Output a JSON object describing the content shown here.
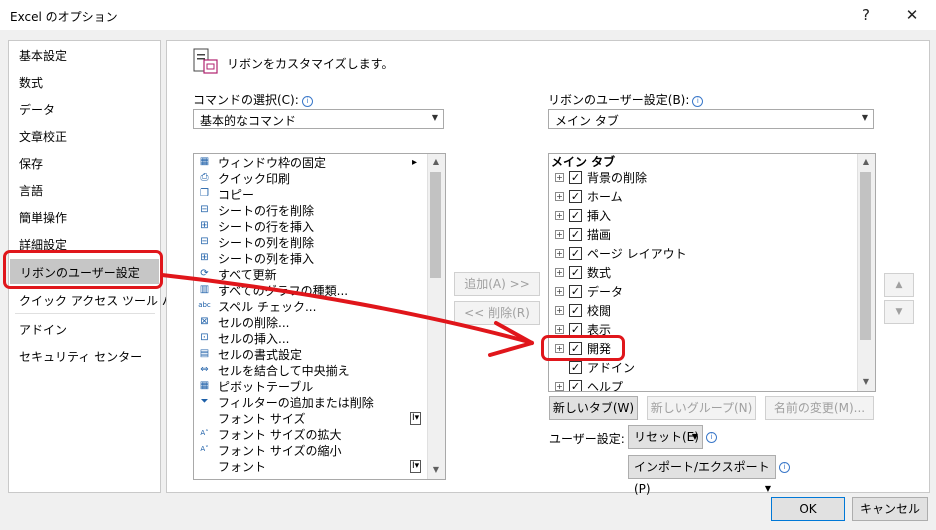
{
  "window": {
    "title": "Excel のオプション",
    "help": "?",
    "close": "✕"
  },
  "nav": {
    "items": [
      {
        "label": "基本設定"
      },
      {
        "label": "数式"
      },
      {
        "label": "データ"
      },
      {
        "label": "文章校正"
      },
      {
        "label": "保存"
      },
      {
        "label": "言語"
      },
      {
        "label": "簡単操作"
      },
      {
        "label": "詳細設定"
      },
      {
        "label": "リボンのユーザー設定"
      },
      {
        "label": "クイック アクセス ツール バー"
      },
      {
        "label": "アドイン"
      },
      {
        "label": "セキュリティ センター"
      }
    ]
  },
  "main": {
    "heading": "リボンをカスタマイズします。",
    "commands_label": "コマンドの選択(C):",
    "commands_value": "基本的なコマンド",
    "ribbon_label": "リボンのユーザー設定(B):",
    "ribbon_value": "メイン タブ",
    "commands": [
      {
        "label": "ウィンドウ枠の固定",
        "icon": "▦",
        "arrow": "▸"
      },
      {
        "label": "クイック印刷",
        "icon": "⎙"
      },
      {
        "label": "コピー",
        "icon": "❐"
      },
      {
        "label": "シートの行を削除",
        "icon": "⊟"
      },
      {
        "label": "シートの行を挿入",
        "icon": "⊞"
      },
      {
        "label": "シートの列を削除",
        "icon": "⊟"
      },
      {
        "label": "シートの列を挿入",
        "icon": "⊞"
      },
      {
        "label": "すべて更新",
        "icon": "⟳"
      },
      {
        "label": "すべてのグラフの種類...",
        "icon": "▥"
      },
      {
        "label": "スペル チェック...",
        "icon": "abc"
      },
      {
        "label": "セルの削除...",
        "icon": "⊠"
      },
      {
        "label": "セルの挿入...",
        "icon": "⊡"
      },
      {
        "label": "セルの書式設定",
        "icon": "▤"
      },
      {
        "label": "セルを結合して中央揃え",
        "icon": "⇔"
      },
      {
        "label": "ピボットテーブル",
        "icon": "▦"
      },
      {
        "label": "フィルターの追加または削除",
        "icon": "⏷"
      },
      {
        "label": "フォント サイズ",
        "icon": "",
        "right": "I▾"
      },
      {
        "label": "フォント サイズの拡大",
        "icon": "A˄"
      },
      {
        "label": "フォント サイズの縮小",
        "icon": "A˅"
      },
      {
        "label": "フォント",
        "icon": "",
        "right": "I▾"
      }
    ],
    "add_button": "追加(A) >>",
    "remove_button": "<< 削除(R)",
    "tabs_header": "メイン タブ",
    "tabs": [
      {
        "label": "背景の削除",
        "expand": "⊞",
        "checked": "✓"
      },
      {
        "label": "ホーム",
        "expand": "⊞",
        "checked": "✓"
      },
      {
        "label": "挿入",
        "expand": "⊞",
        "checked": "✓"
      },
      {
        "label": "描画",
        "expand": "⊞",
        "checked": "✓"
      },
      {
        "label": "ページ レイアウト",
        "expand": "⊞",
        "checked": "✓"
      },
      {
        "label": "数式",
        "expand": "⊞",
        "checked": "✓"
      },
      {
        "label": "データ",
        "expand": "⊞",
        "checked": "✓"
      },
      {
        "label": "校閲",
        "expand": "⊞",
        "checked": "✓"
      },
      {
        "label": "表示",
        "expand": "⊞",
        "checked": "✓"
      },
      {
        "label": "開発",
        "expand": "⊞",
        "checked": "✓"
      },
      {
        "label": "アドイン",
        "expand": "",
        "checked": "✓"
      },
      {
        "label": "ヘルプ",
        "expand": "⊞",
        "checked": "✓"
      }
    ],
    "new_tab": "新しいタブ(W)",
    "new_group": "新しいグループ(N)",
    "rename": "名前の変更(M)...",
    "custom_label": "ユーザー設定:",
    "reset": "リセット(E)",
    "import_export": "インポート/エクスポート(P)",
    "up": "▲",
    "down": "▼"
  },
  "footer": {
    "ok": "OK",
    "cancel": "キャンセル"
  },
  "colors": {
    "accent": "#e0161b",
    "selected": "#c6c6c6"
  }
}
